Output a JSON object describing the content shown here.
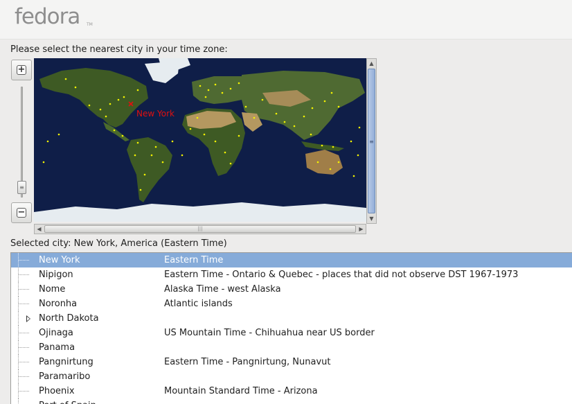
{
  "header": {
    "logo_text": "fedora",
    "logo_tm": "TM"
  },
  "prompt": "Please select the nearest city in your time zone:",
  "map": {
    "marker_city": "New York",
    "marker_color": "#e01010",
    "city_dot_color": "#f4f400",
    "ocean_color": "#0f1e48",
    "land_color": "#3e5a24",
    "desert_color": "#b49860",
    "ice_color": "#e6ecf0"
  },
  "zoom": {
    "in_icon": "plus-icon",
    "out_icon": "minus-icon"
  },
  "selected_city": "Selected city: New York, America (Eastern Time)",
  "cities": [
    {
      "city": "New York",
      "zone": "Eastern Time",
      "selected": true,
      "expandable": false
    },
    {
      "city": "Nipigon",
      "zone": "Eastern Time - Ontario & Quebec - places that did not observe DST 1967-1973",
      "selected": false,
      "expandable": false
    },
    {
      "city": "Nome",
      "zone": "Alaska Time - west Alaska",
      "selected": false,
      "expandable": false
    },
    {
      "city": "Noronha",
      "zone": "Atlantic islands",
      "selected": false,
      "expandable": false
    },
    {
      "city": "North Dakota",
      "zone": "",
      "selected": false,
      "expandable": true
    },
    {
      "city": "Ojinaga",
      "zone": "US Mountain Time - Chihuahua near US border",
      "selected": false,
      "expandable": false
    },
    {
      "city": "Panama",
      "zone": "",
      "selected": false,
      "expandable": false
    },
    {
      "city": "Pangnirtung",
      "zone": "Eastern Time - Pangnirtung, Nunavut",
      "selected": false,
      "expandable": false
    },
    {
      "city": "Paramaribo",
      "zone": "",
      "selected": false,
      "expandable": false
    },
    {
      "city": "Phoenix",
      "zone": "Mountain Standard Time - Arizona",
      "selected": false,
      "expandable": false
    },
    {
      "city": "Port of Spain",
      "zone": "",
      "selected": false,
      "expandable": false
    }
  ]
}
